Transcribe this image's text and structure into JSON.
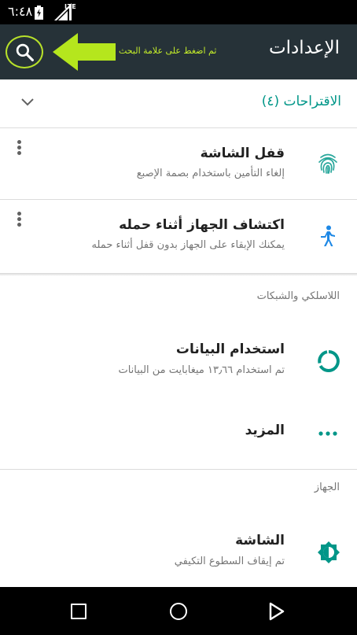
{
  "status_bar": {
    "time": "٦:٤٨",
    "network": "LTE",
    "icons": [
      "battery-charging-icon",
      "signal-icon"
    ]
  },
  "app_bar": {
    "title": "الإعدادات",
    "search_icon": "search-icon",
    "annotation": "ثم اضغط على علامة البحث",
    "annotation_color": "#c5ee2a",
    "background": "#263238"
  },
  "suggestions": {
    "title": "الاقتراحات (٤)",
    "accent": "#009688",
    "items": [
      {
        "title": "قفل الشاشة",
        "subtitle": "إلغاء التأمين باستخدام بصمة الإصبع",
        "icon": "fingerprint-icon"
      },
      {
        "title": "اكتشاف الجهاز أثناء حمله",
        "subtitle": "يمكنك الإبقاء على الجهاز بدون قفل أثناء حمله",
        "icon": "walking-person-icon"
      }
    ]
  },
  "sections": {
    "wireless": {
      "label": "اللاسلكي والشبكات",
      "items": [
        {
          "title": "استخدام البيانات",
          "subtitle": "تم استخدام ١٣٫٦٦ ميغابايت من البيانات",
          "icon": "data-usage-icon"
        },
        {
          "title": "المزيد",
          "icon": "more-horiz-icon"
        }
      ]
    },
    "device": {
      "label": "الجهاز",
      "items": [
        {
          "title": "الشاشة",
          "subtitle": "تم إيقاف السطوع التكيفي",
          "icon": "brightness-icon"
        }
      ]
    }
  },
  "nav_bar": {
    "buttons": [
      "recents-icon",
      "home-icon",
      "back-icon"
    ]
  }
}
